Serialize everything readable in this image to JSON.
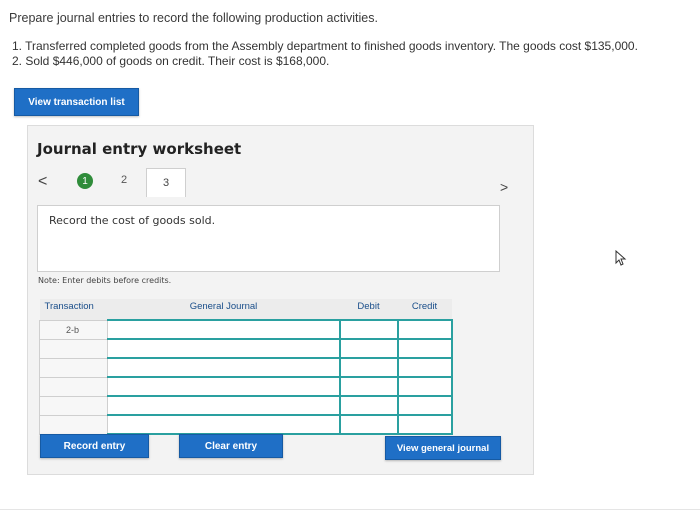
{
  "intro": "Prepare journal entries to record the following production activities.",
  "activities": [
    "1. Transferred completed goods from the Assembly department to finished goods inventory. The goods cost $135,000.",
    "2. Sold $446,000 of goods on credit. Their cost is $168,000."
  ],
  "view_transaction_list": "View transaction list",
  "worksheet": {
    "title": "Journal entry worksheet",
    "prev": "<",
    "next": ">",
    "steps": [
      "1",
      "2",
      "3"
    ],
    "description": "Record the cost of goods sold.",
    "note": "Note: Enter debits before credits."
  },
  "table": {
    "headers": {
      "transaction": "Transaction",
      "general_journal": "General Journal",
      "debit": "Debit",
      "credit": "Credit"
    },
    "rows": [
      {
        "transaction": "2-b",
        "account": "",
        "debit": "",
        "credit": ""
      },
      {
        "transaction": "",
        "account": "",
        "debit": "",
        "credit": ""
      },
      {
        "transaction": "",
        "account": "",
        "debit": "",
        "credit": ""
      },
      {
        "transaction": "",
        "account": "",
        "debit": "",
        "credit": ""
      },
      {
        "transaction": "",
        "account": "",
        "debit": "",
        "credit": ""
      },
      {
        "transaction": "",
        "account": "",
        "debit": "",
        "credit": ""
      }
    ]
  },
  "buttons": {
    "record": "Record entry",
    "clear": "Clear entry",
    "view_journal": "View general journal"
  },
  "colors": {
    "accent": "#1f6fc6",
    "step_done": "#2f8c3a",
    "row_border": "#2aa0a0"
  },
  "icons": {
    "cursor": "pointer-cursor-icon"
  }
}
